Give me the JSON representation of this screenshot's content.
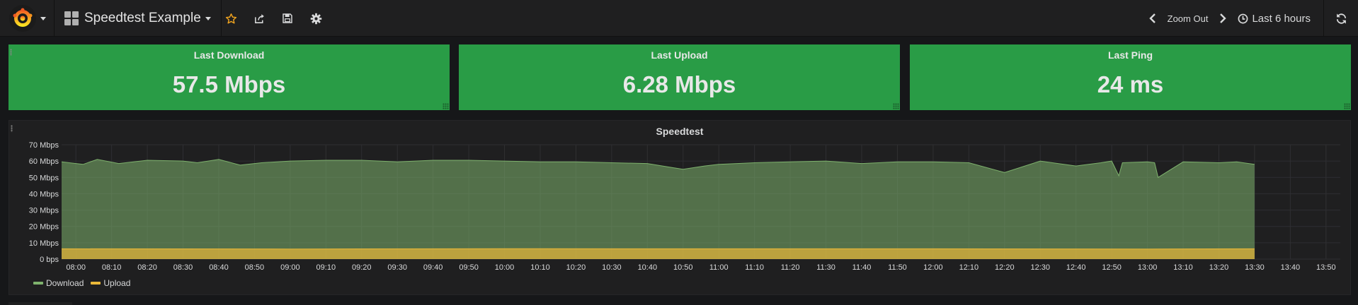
{
  "navbar": {
    "dashboard_title": "Speedtest Example",
    "zoom_out_label": "Zoom Out",
    "time_range": "Last 6 hours"
  },
  "stats": [
    {
      "title": "Last Download",
      "value": "57.5 Mbps"
    },
    {
      "title": "Last Upload",
      "value": "6.28 Mbps"
    },
    {
      "title": "Last Ping",
      "value": "24 ms"
    }
  ],
  "colors": {
    "stat_background": "#299c46",
    "download_series": "#7eb26d",
    "upload_series": "#eab839",
    "accent_star": "#f2a51f"
  },
  "chart_data": {
    "type": "area",
    "title": "Speedtest",
    "xlabel": "",
    "ylabel": "",
    "ylim": [
      0,
      70
    ],
    "y_ticks": [
      "0 bps",
      "10 Mbps",
      "20 Mbps",
      "30 Mbps",
      "40 Mbps",
      "50 Mbps",
      "60 Mbps",
      "70 Mbps"
    ],
    "y_tick_values": [
      0,
      10,
      20,
      30,
      40,
      50,
      60,
      70
    ],
    "x_ticks": [
      "08:00",
      "08:10",
      "08:20",
      "08:30",
      "08:40",
      "08:50",
      "09:00",
      "09:10",
      "09:20",
      "09:30",
      "09:40",
      "09:50",
      "10:00",
      "10:10",
      "10:20",
      "10:30",
      "10:40",
      "10:50",
      "11:00",
      "11:10",
      "11:20",
      "11:30",
      "11:40",
      "11:50",
      "12:00",
      "12:10",
      "12:20",
      "12:30",
      "12:40",
      "12:50",
      "13:00",
      "13:10",
      "13:20",
      "13:30",
      "13:40",
      "13:50"
    ],
    "x_range": [
      "07:56",
      "13:54"
    ],
    "grid": true,
    "legend_position": "bottom-left",
    "series": [
      {
        "name": "Download",
        "x": [
          "07:56",
          "08:02",
          "08:06",
          "08:12",
          "08:20",
          "08:30",
          "08:34",
          "08:40",
          "08:46",
          "08:52",
          "09:00",
          "09:10",
          "09:20",
          "09:30",
          "09:40",
          "09:50",
          "10:00",
          "10:10",
          "10:20",
          "10:30",
          "10:40",
          "10:47",
          "10:50",
          "10:56",
          "11:00",
          "11:10",
          "11:20",
          "11:30",
          "11:40",
          "11:50",
          "12:00",
          "12:10",
          "12:20",
          "12:30",
          "12:40",
          "12:47",
          "12:50",
          "12:52",
          "12:53",
          "13:00",
          "13:02",
          "13:03",
          "13:10",
          "13:20",
          "13:25",
          "13:30"
        ],
        "values": [
          59.5,
          58,
          61,
          58.5,
          60.5,
          60,
          59,
          61,
          57.5,
          59,
          60,
          60.5,
          60.5,
          59.5,
          60.5,
          60.5,
          60,
          59.5,
          59.5,
          59,
          58.5,
          56,
          55,
          57,
          58,
          59,
          59.5,
          60,
          58.5,
          59.5,
          59.5,
          59,
          53,
          60,
          57,
          59,
          60,
          51,
          59,
          59.5,
          59,
          50,
          59.5,
          59,
          59.5,
          58
        ]
      },
      {
        "name": "Upload",
        "x": [
          "07:56",
          "09:00",
          "10:00",
          "11:00",
          "12:00",
          "13:00",
          "13:30"
        ],
        "values": [
          6.3,
          6.2,
          6.4,
          6.3,
          6.3,
          6.2,
          6.3
        ]
      }
    ]
  }
}
